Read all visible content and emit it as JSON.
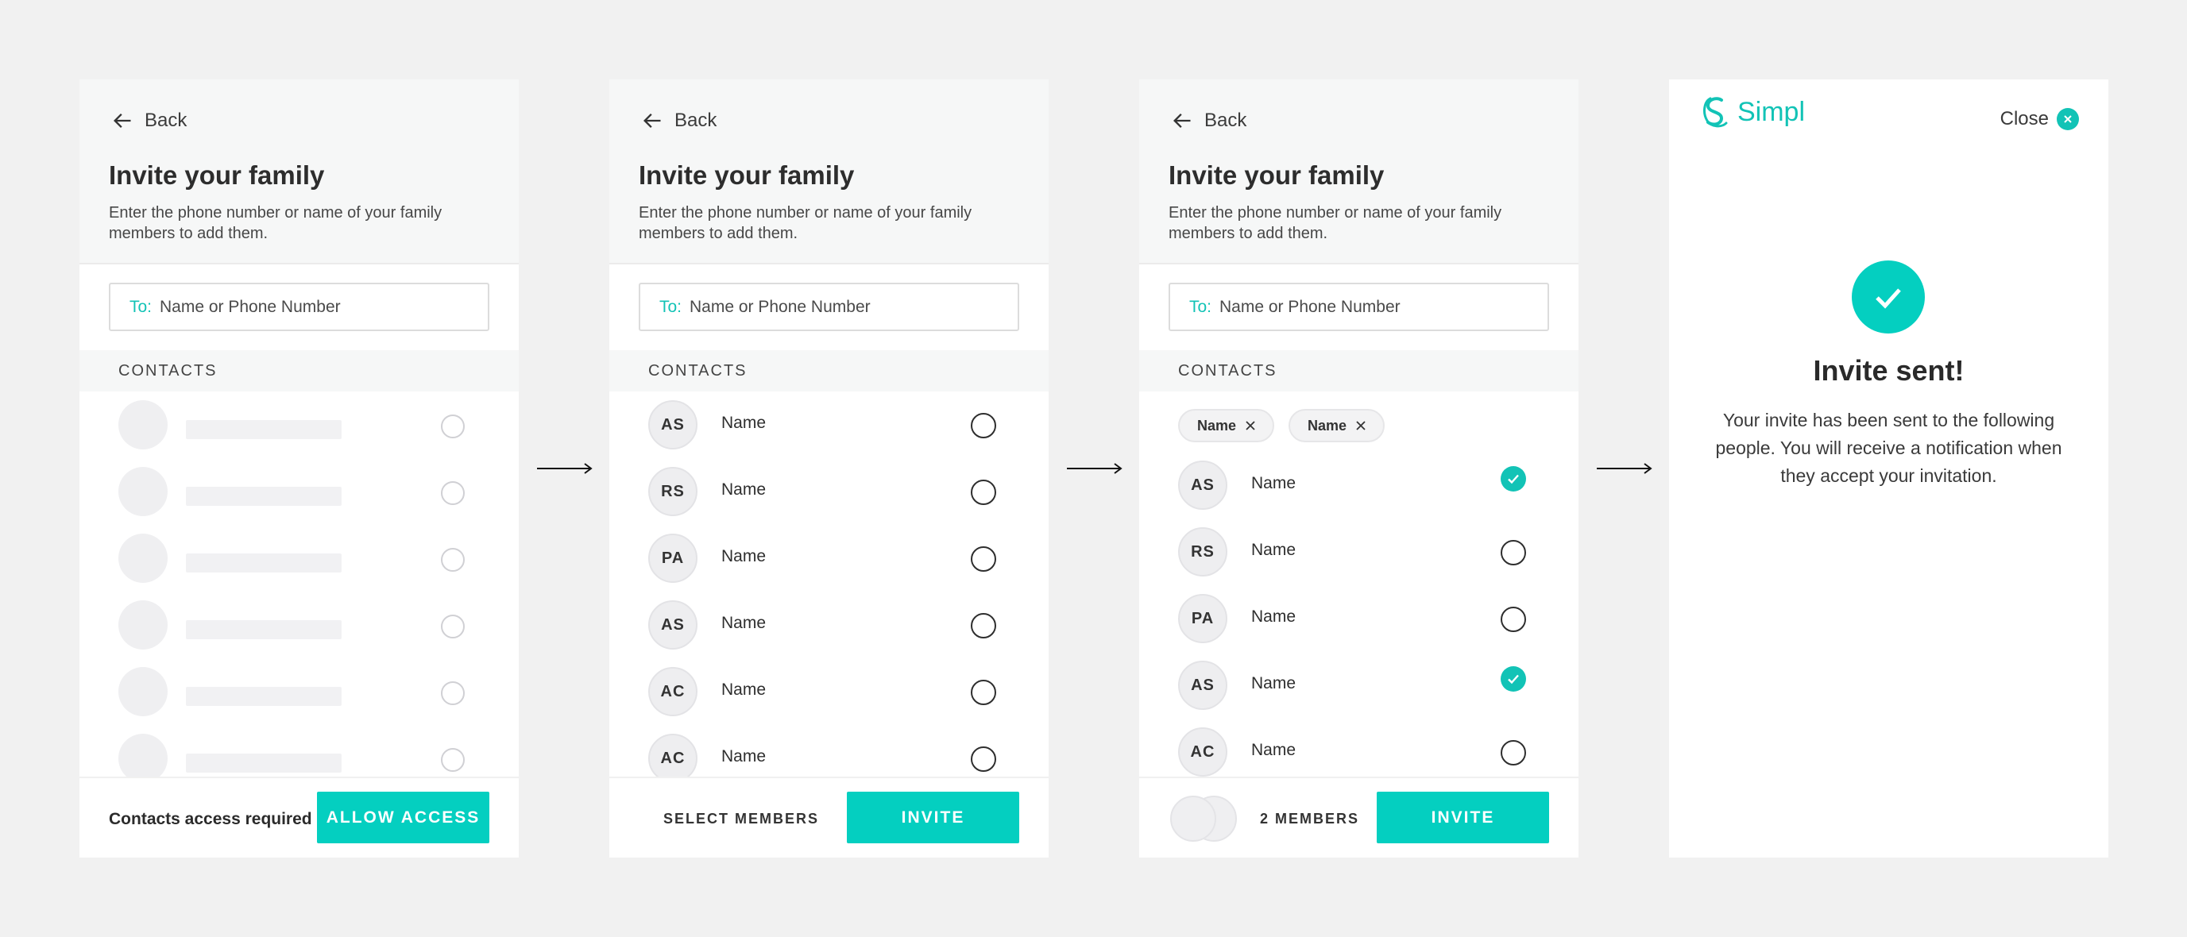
{
  "colors": {
    "accent": "#04cfc0",
    "page_bg": "#f1f1f1",
    "header_bg": "#f6f7f7"
  },
  "screens": [
    {
      "back_label": "Back",
      "title": "Invite your family",
      "subtitle": "Enter the phone number or name of your family members to add them.",
      "to_label": "To:",
      "to_placeholder": "Name or Phone Number",
      "contacts_label": "CONTACTS",
      "footer_text": "Contacts access required",
      "cta_label": "ALLOW ACCESS"
    },
    {
      "back_label": "Back",
      "title": "Invite your family",
      "subtitle": "Enter the phone number or name of your family members to add them.",
      "to_label": "To:",
      "to_placeholder": "Name or Phone Number",
      "contacts_label": "CONTACTS",
      "contacts": [
        {
          "initials": "AS",
          "name": "Name",
          "selected": false
        },
        {
          "initials": "RS",
          "name": "Name",
          "selected": false
        },
        {
          "initials": "PA",
          "name": "Name",
          "selected": false
        },
        {
          "initials": "AS",
          "name": "Name",
          "selected": false
        },
        {
          "initials": "AC",
          "name": "Name",
          "selected": false
        },
        {
          "initials": "AC",
          "name": "Name",
          "selected": false
        }
      ],
      "footer_text": "SELECT MEMBERS",
      "cta_label": "INVITE"
    },
    {
      "back_label": "Back",
      "title": "Invite your family",
      "subtitle": "Enter the phone number or name of your family members to add them.",
      "to_label": "To:",
      "to_placeholder": "Name or Phone Number",
      "contacts_label": "CONTACTS",
      "chips": [
        "Name",
        "Name"
      ],
      "contacts": [
        {
          "initials": "AS",
          "name": "Name",
          "selected": true
        },
        {
          "initials": "RS",
          "name": "Name",
          "selected": false
        },
        {
          "initials": "PA",
          "name": "Name",
          "selected": false
        },
        {
          "initials": "AS",
          "name": "Name",
          "selected": true
        },
        {
          "initials": "AC",
          "name": "Name",
          "selected": false
        }
      ],
      "footer_text": "2 MEMBERS",
      "cta_label": "INVITE"
    },
    {
      "brand": "Simpl",
      "close_label": "Close",
      "title": "Invite sent!",
      "body": "Your invite has been sent to the following people. You will receive a notification when they accept your invitation."
    }
  ]
}
